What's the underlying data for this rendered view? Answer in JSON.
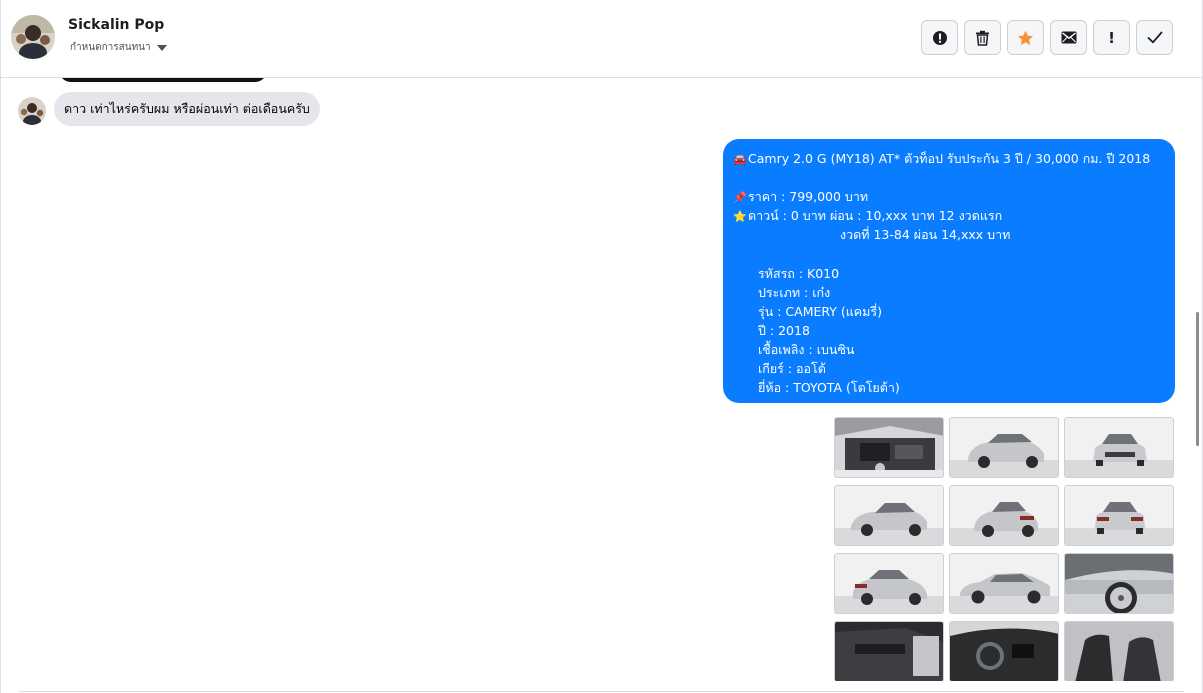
{
  "header": {
    "contact_name": "Sickalin Pop",
    "contact_sub": "กำหนดการสนทนา",
    "toolbar": [
      {
        "name": "report-button",
        "icon": "alert-circle-icon"
      },
      {
        "name": "delete-button",
        "icon": "trash-icon"
      },
      {
        "name": "star-button",
        "icon": "star-icon"
      },
      {
        "name": "mail-button",
        "icon": "envelope-icon"
      },
      {
        "name": "priority-button",
        "icon": "exclamation-icon"
      },
      {
        "name": "done-button",
        "icon": "checkmark-icon"
      }
    ],
    "star_color": "#f7923a"
  },
  "incoming_message": {
    "text": "ดาว เท่าไหร่ครับผม หรือผ่อนเท่า ต่อเดือนครับ"
  },
  "outgoing_message": {
    "color": "#0a7cff",
    "title": "Camry 2.0 G (MY18) AT* ตัวท็อป รับประกัน 3 ปี / 30,000 กม. ปี 2018",
    "price": "ราคา : 799,000 บาท",
    "down": "ดาวน์ : 0 บาท ผ่อน : 10,xxx บาท 12 งวดแรก",
    "installment": "งวดที่ 13-84 ผ่อน 14,xxx บาท",
    "code": "รหัสรถ : K010",
    "type": "ประเภท : เก๋ง",
    "model": "รุ่น : CAMERY (แคมรี่)",
    "year": "ปี : 2018",
    "fuel": "เชื้อเพลิง : เบนซิน",
    "gear": "เกียร์ : ออโต้",
    "brand": "ยี่ห้อ : TOYOTA (โตโยต้า)"
  },
  "gallery": [
    {
      "name": "engine-bay-photo"
    },
    {
      "name": "car-front-left-photo"
    },
    {
      "name": "car-front-photo"
    },
    {
      "name": "car-rear-left-photo"
    },
    {
      "name": "car-rear-quarter-photo"
    },
    {
      "name": "car-rear-photo"
    },
    {
      "name": "car-rear-right-photo"
    },
    {
      "name": "car-side-photo"
    },
    {
      "name": "car-wheel-photo"
    },
    {
      "name": "door-interior-photo"
    },
    {
      "name": "dashboard-photo"
    },
    {
      "name": "seats-interior-photo"
    }
  ]
}
